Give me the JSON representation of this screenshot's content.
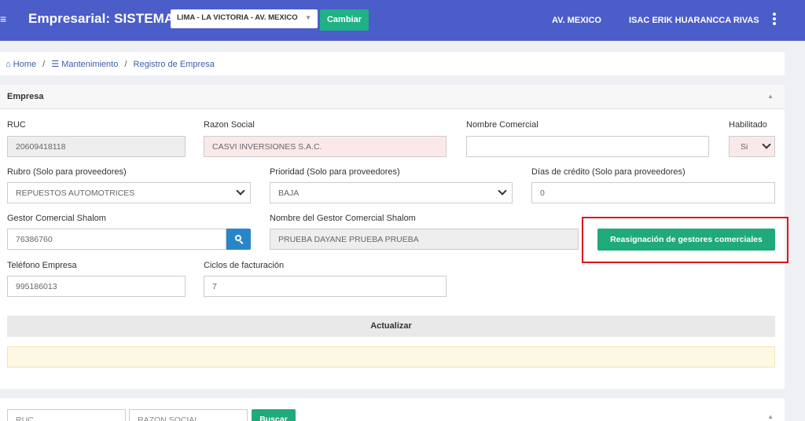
{
  "navbar": {
    "brand": "Empresarial: SISTEMAS",
    "sede": "LIMA - LA VICTORIA - AV. MEXICO",
    "cambiar": "Cambiar",
    "sucursal": "AV. MEXICO",
    "user": "ISAC ERIK HUARANCCA RIVAS",
    "accent": "#4b5dc9"
  },
  "breadcrumb": {
    "home": "Home",
    "mantenimiento": "Mantenimiento",
    "current": "Registro de Empresa",
    "sep": "/"
  },
  "empresa": {
    "title": "Empresa",
    "ruc_label": "RUC",
    "ruc_value": "20609418118",
    "razon_label": "Razon Social",
    "razon_value": "CASVI INVERSIONES S.A.C.",
    "nombre_label": "Nombre Comercial",
    "nombre_value": "",
    "habilitado_label": "Habilitado",
    "habilitado_value": "Si",
    "rubro_label": "Rubro (Solo para proveedores)",
    "rubro_value": "REPUESTOS AUTOMOTRICES",
    "prioridad_label": "Prioridad (Solo para proveedores)",
    "prioridad_value": "BAJA",
    "dias_label": "Días de crédito (Solo para proveedores)",
    "dias_value": "0",
    "gestor_label": "Gestor Comercial Shalom",
    "gestor_value": "76386760",
    "nombre_gestor_label": "Nombre del Gestor Comercial Shalom",
    "nombre_gestor_value": "PRUEBA DAYANE  PRUEBA  PRUEBA",
    "reasignacion": "Reasignación de gestores comerciales",
    "telefono_label": "Teléfono Empresa",
    "telefono_value": "995186013",
    "ciclos_label": "Ciclos de facturación",
    "ciclos_value": "7",
    "actualizar": "Actualizar"
  },
  "search": {
    "ruc_placeholder": "RUC",
    "razon_placeholder": "RAZON SOCIAL",
    "buscar": "Buscar"
  },
  "colors": {
    "green": "#20a97c",
    "highlight": "#e0141c",
    "search_blue": "#2a86c8"
  }
}
